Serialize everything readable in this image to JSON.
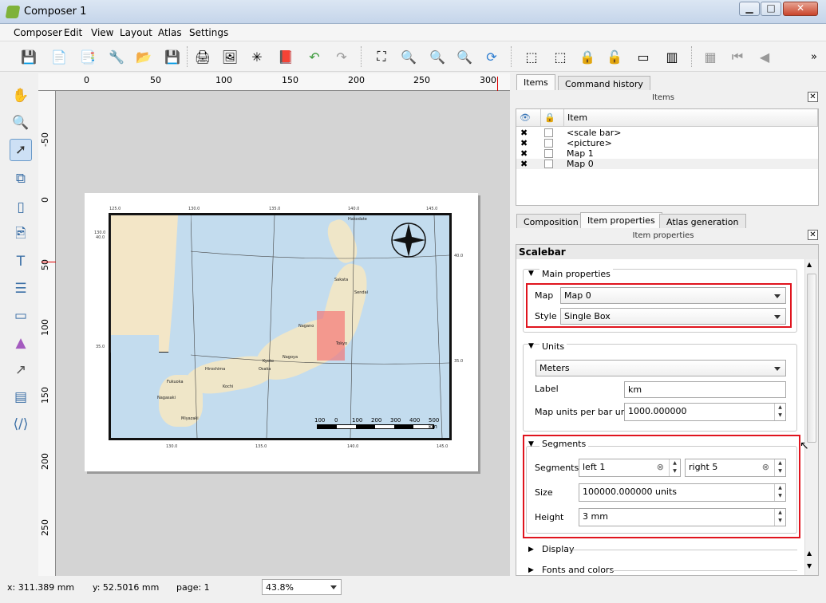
{
  "window": {
    "title": "Composer 1",
    "min": "▁",
    "max": "□",
    "close": "✕"
  },
  "menu": [
    "Composer",
    "Edit",
    "View",
    "Layout",
    "Atlas",
    "Settings"
  ],
  "ruler": {
    "top": [
      "0",
      "50",
      "100",
      "150",
      "200",
      "250",
      "300"
    ],
    "left": [
      "-50",
      "0",
      "50",
      "100",
      "150",
      "200",
      "250"
    ]
  },
  "map": {
    "top_ticks": [
      "125.0",
      "130.0",
      "135.0",
      "140.0",
      "145.0"
    ],
    "bottom_ticks": [
      "130.0",
      "135.0",
      "140.0",
      "145.0"
    ],
    "right_ticks": [
      "40.0",
      "35.0"
    ],
    "left_ticks": [
      "130.0",
      "40.0",
      "35.0"
    ],
    "cities": [
      "Hakodate",
      "Sakata",
      "Sendai",
      "Nagano",
      "Tokyo",
      "Nagoya",
      "Kyoto",
      "Osaka",
      "Hiroshima",
      "Kochi",
      "Fukuoka",
      "Nagasaki",
      "Miyazaki"
    ],
    "scalebar_labels": [
      "100",
      "0",
      "100",
      "200",
      "300",
      "400",
      "500 km"
    ]
  },
  "tabs_top": {
    "items": "Items",
    "history": "Command history"
  },
  "items_panel": {
    "title": "Items",
    "header": "Item",
    "rows": [
      "<scale bar>",
      "<picture>",
      "Map 1",
      "Map 0"
    ]
  },
  "tabs_bottom": {
    "composition": "Composition",
    "item_props": "Item properties",
    "atlas": "Atlas generation"
  },
  "props_panel": {
    "title": "Item properties",
    "heading": "Scalebar",
    "main": {
      "title": "Main properties",
      "map_label": "Map",
      "map_value": "Map 0",
      "style_label": "Style",
      "style_value": "Single Box"
    },
    "units": {
      "title": "Units",
      "units_value": "Meters",
      "label_label": "Label",
      "label_value": "km",
      "mupb_label": "Map units per bar unit",
      "mupb_value": "1000.000000"
    },
    "segments": {
      "title": "Segments",
      "seg_label": "Segments",
      "left_value": "left 1",
      "right_value": "right 5",
      "size_label": "Size",
      "size_value": "100000.000000 units",
      "height_label": "Height",
      "height_value": "3 mm"
    },
    "display": "Display",
    "fonts": "Fonts and colors"
  },
  "status": {
    "x": "x: 311.389 mm",
    "y": "y: 52.5016 mm",
    "page": "page: 1",
    "zoom": "43.8%"
  }
}
